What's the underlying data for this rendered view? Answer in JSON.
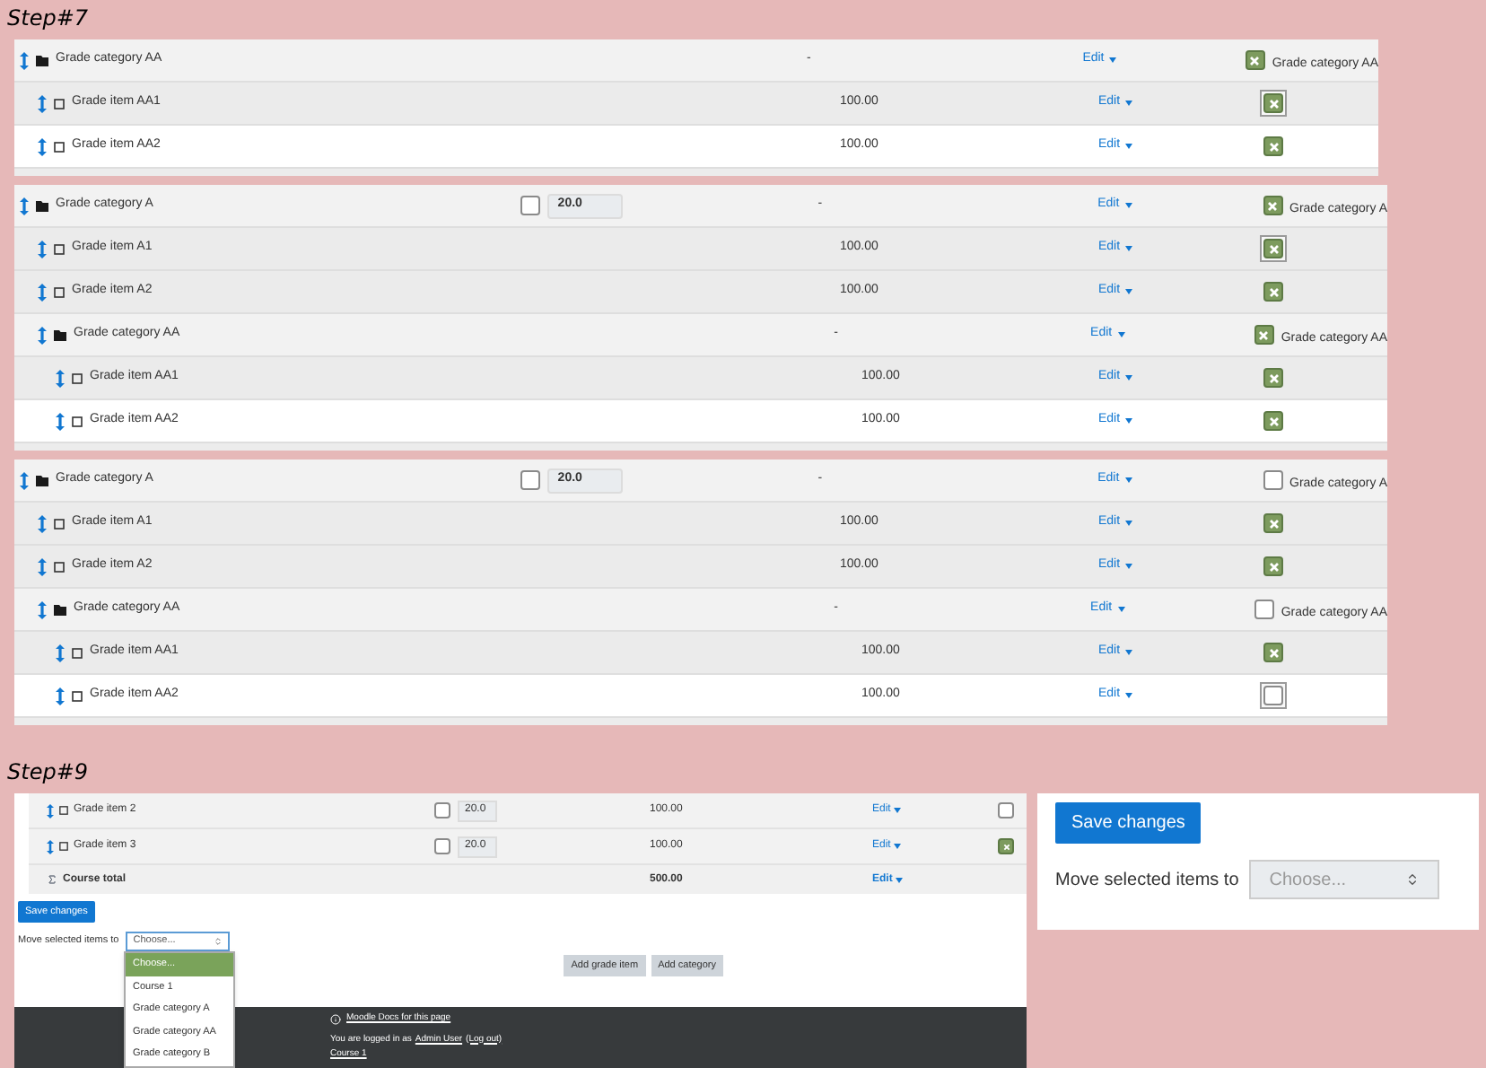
{
  "step_7": {
    "title": "Step#7",
    "tables": [
      {
        "rows": [
          {
            "kind": "category",
            "name": "Grade category AA",
            "total": "-",
            "action": "Edit",
            "select": {
              "checked": true,
              "focused": false,
              "label": "Grade category AA"
            },
            "children": [
              {
                "kind": "item",
                "name": "Grade item AA1",
                "total": "100.00",
                "action": "Edit",
                "select": {
                  "checked": true,
                  "focused": true
                }
              },
              {
                "kind": "item",
                "name": "Grade item AA2",
                "total": "100.00",
                "action": "Edit",
                "select": {
                  "checked": true,
                  "focused": false
                }
              }
            ]
          }
        ]
      },
      {
        "rows": [
          {
            "kind": "category",
            "name": "Grade category A",
            "weight": {
              "checked": false,
              "value": "20.0"
            },
            "total": "-",
            "action": "Edit",
            "select": {
              "checked": true,
              "focused": false,
              "label": "Grade category A"
            },
            "children": [
              {
                "kind": "item",
                "name": "Grade item A1",
                "total": "100.00",
                "action": "Edit",
                "select": {
                  "checked": true,
                  "focused": true
                }
              },
              {
                "kind": "item",
                "name": "Grade item A2",
                "total": "100.00",
                "action": "Edit",
                "select": {
                  "checked": true,
                  "focused": false
                }
              },
              {
                "kind": "category",
                "name": "Grade category AA",
                "total": "-",
                "action": "Edit",
                "select": {
                  "checked": true,
                  "focused": false,
                  "label": "Grade category AA"
                },
                "children": [
                  {
                    "kind": "item",
                    "name": "Grade item AA1",
                    "total": "100.00",
                    "action": "Edit",
                    "select": {
                      "checked": true,
                      "focused": false
                    }
                  },
                  {
                    "kind": "item",
                    "name": "Grade item AA2",
                    "total": "100.00",
                    "action": "Edit",
                    "select": {
                      "checked": true,
                      "focused": false
                    }
                  }
                ]
              }
            ]
          }
        ]
      },
      {
        "rows": [
          {
            "kind": "category",
            "name": "Grade category A",
            "weight": {
              "checked": false,
              "value": "20.0"
            },
            "total": "-",
            "action": "Edit",
            "select": {
              "checked": false,
              "focused": false,
              "label": "Grade category A"
            },
            "children": [
              {
                "kind": "item",
                "name": "Grade item A1",
                "total": "100.00",
                "action": "Edit",
                "select": {
                  "checked": true,
                  "focused": false
                }
              },
              {
                "kind": "item",
                "name": "Grade item A2",
                "total": "100.00",
                "action": "Edit",
                "select": {
                  "checked": true,
                  "focused": false
                }
              },
              {
                "kind": "category",
                "name": "Grade category AA",
                "total": "-",
                "action": "Edit",
                "select": {
                  "checked": false,
                  "focused": false,
                  "label": "Grade category AA"
                },
                "children": [
                  {
                    "kind": "item",
                    "name": "Grade item AA1",
                    "total": "100.00",
                    "action": "Edit",
                    "select": {
                      "checked": true,
                      "focused": false
                    }
                  },
                  {
                    "kind": "item",
                    "name": "Grade item AA2",
                    "total": "100.00",
                    "action": "Edit",
                    "select": {
                      "checked": false,
                      "focused": true
                    }
                  }
                ]
              }
            ]
          }
        ]
      }
    ]
  },
  "step_9": {
    "title": "Step#9",
    "page": {
      "rows": [
        {
          "kind": "item",
          "name": "Grade item 2",
          "weight": {
            "checked": false,
            "value": "20.0"
          },
          "total": "100.00",
          "action": "Edit",
          "select": {
            "checked": false
          }
        },
        {
          "kind": "item",
          "name": "Grade item 3",
          "weight": {
            "checked": false,
            "value": "20.0"
          },
          "total": "100.00",
          "action": "Edit",
          "select": {
            "checked": true
          }
        },
        {
          "kind": "total",
          "name": "Course total",
          "total": "500.00",
          "action": "Edit"
        }
      ],
      "save_button": "Save changes",
      "move_label": "Move selected items to",
      "move_select": {
        "value": "Choose...",
        "expanded": true,
        "options": [
          {
            "label": "Choose...",
            "selected": true
          },
          {
            "label": "Course 1",
            "selected": false
          },
          {
            "label": "Grade category A",
            "selected": false
          },
          {
            "label": "Grade category AA",
            "selected": false
          },
          {
            "label": "Grade category B",
            "selected": false
          }
        ]
      },
      "buttons": [
        "Add grade item",
        "Add category"
      ],
      "footer": {
        "docs_link": "Moodle Docs for this page",
        "login_text": "You are logged in as",
        "user_link": "Admin User",
        "logout_link": "(Log out)",
        "course_link": "Course 1"
      }
    },
    "panel": {
      "save_button": "Save changes",
      "move_label": "Move selected items to",
      "move_select": {
        "placeholder": "Choose..."
      }
    }
  }
}
